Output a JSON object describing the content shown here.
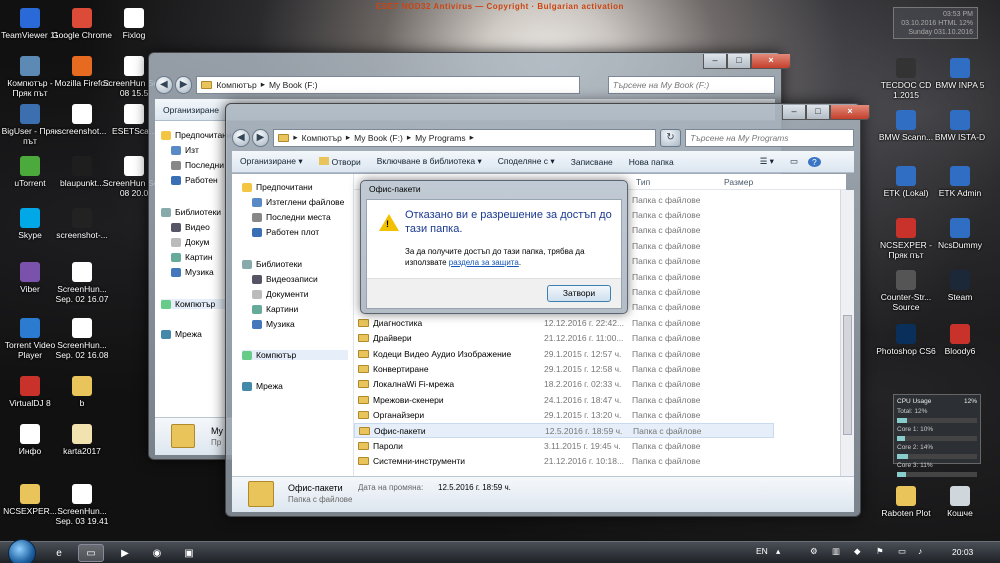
{
  "watermark": "ESET NOD32 Antivirus — Copyright · Bulgarian activation",
  "clock_widget": [
    "03:53 PM",
    "03.10.2016 HTML 12%",
    "Sunday 031.10.2016"
  ],
  "desktop_left": [
    {
      "label": "TeamViewer 11",
      "icon": "teamviewer-icon",
      "color": "#2a6ad8"
    },
    {
      "label": "Google Chrome",
      "icon": "chrome-icon",
      "color": "#dc4a38"
    },
    {
      "label": "Fixlog",
      "icon": "text-file-icon",
      "color": "#ffffff"
    },
    {
      "label": "Компютър - Пряк път",
      "icon": "computer-shortcut-icon",
      "color": "#5c8ab5"
    },
    {
      "label": "Mozilla Firefox",
      "icon": "firefox-icon",
      "color": "#e66a1f"
    },
    {
      "label": "ScreenHun Sep. 08 15.5",
      "icon": "screenshot-file-icon",
      "color": "#ffffff"
    },
    {
      "label": "BigUser - Пряк път",
      "icon": "user-shortcut-icon",
      "color": "#3b6fb0"
    },
    {
      "label": "screenshot...",
      "icon": "screenshot-file-icon",
      "color": "#ffffff"
    },
    {
      "label": "ESETSca...",
      "icon": "eset-icon",
      "color": "#ffffff"
    },
    {
      "label": "uTorrent",
      "icon": "utorrent-icon",
      "color": "#4caa3c"
    },
    {
      "label": "blaupunkt...",
      "icon": "folder-icon",
      "color": "#1e1e1e"
    },
    {
      "label": "ScreenHun Sep. 08 20.0",
      "icon": "screenshot-file-icon",
      "color": "#ffffff"
    },
    {
      "label": "Skype",
      "icon": "skype-icon",
      "color": "#00a8e8"
    },
    {
      "label": "screenshot-...",
      "icon": "screenshot-file-icon",
      "color": "#222222"
    },
    {
      "label": "Viber",
      "icon": "viber-icon",
      "color": "#7b52ab"
    },
    {
      "label": "ScreenHun... Sep. 02 16.07",
      "icon": "screenshot-file-icon",
      "color": "#ffffff"
    },
    {
      "label": "Torrent Video Player",
      "icon": "torrent-player-icon",
      "color": "#2b7bd0"
    },
    {
      "label": "ScreenHun... Sep. 02 16.08",
      "icon": "screenshot-file-icon",
      "color": "#ffffff"
    },
    {
      "label": "VirtualDJ 8",
      "icon": "virtualdj-icon",
      "color": "#c8322b"
    },
    {
      "label": "b",
      "icon": "file-icon",
      "color": "#e8c45a"
    },
    {
      "label": "Инфо",
      "icon": "document-icon",
      "color": "#ffffff"
    },
    {
      "label": "karta2017",
      "icon": "zip-icon",
      "color": "#f2e2b0"
    },
    {
      "label": "NCSEXPER...",
      "icon": "ncsexpert-icon",
      "color": "#e8c45a"
    },
    {
      "label": "ScreenHun... Sep. 03 19.41",
      "icon": "screenshot-file-icon",
      "color": "#ffffff"
    }
  ],
  "desktop_right": [
    {
      "label": "TECDOC CD 1.2015",
      "icon": "tecdoc-icon",
      "color": "#333333"
    },
    {
      "label": "BMW INPA 5",
      "icon": "bmw-icon",
      "color": "#2f6ec2"
    },
    {
      "label": "BMW Scann...",
      "icon": "bmw-scanner-icon",
      "color": "#2f6ec2"
    },
    {
      "label": "BMW ISTA-D",
      "icon": "bmw-ista-icon",
      "color": "#2f6ec2"
    },
    {
      "label": "ETK (Lokal)",
      "icon": "etk-icon",
      "color": "#2f6ec2"
    },
    {
      "label": "ETK Admin",
      "icon": "etk-admin-icon",
      "color": "#2f6ec2"
    },
    {
      "label": "NCSEXPER - Пряк път",
      "icon": "ncsexpert-icon",
      "color": "#c8322b"
    },
    {
      "label": "NcsDummy",
      "icon": "ncsdummy-icon",
      "color": "#2f6ec2"
    },
    {
      "label": "Counter-Str... Source",
      "icon": "counter-strike-icon",
      "color": "#555555"
    },
    {
      "label": "Steam",
      "icon": "steam-icon",
      "color": "#1b2838"
    },
    {
      "label": "Photoshop CS6",
      "icon": "photoshop-icon",
      "color": "#0a2f5a"
    },
    {
      "label": "Bloody6",
      "icon": "bloody-icon",
      "color": "#c8322b"
    },
    {
      "label": "Raboten Plot",
      "icon": "folder-icon",
      "color": "#e8c45a"
    },
    {
      "label": "Кошче",
      "icon": "recycle-bin-icon",
      "color": "#cfd6dc"
    }
  ],
  "back_window": {
    "path": [
      "Компютър",
      "My Book (F:)"
    ],
    "search_placeholder": "Търсене на My Book (F:)",
    "organize": "Организиране",
    "nav": [
      "Предпочитани",
      "Изт",
      "Последни",
      "Работен",
      "Библиотеки",
      "Видео",
      "Докум",
      "Картин",
      "Музика",
      "Компютър",
      "Мрежа"
    ],
    "details_name": "My",
    "details_type": "Пр"
  },
  "front_window": {
    "path": [
      "Компютър",
      "My Book (F:)",
      "My Programs"
    ],
    "search_placeholder": "Търсене на My Programs",
    "toolbar": [
      "Организиране",
      "Отвори",
      "Включване в библиотека",
      "Споделяне с",
      "Записване",
      "Нова папка"
    ],
    "columns": {
      "type": "Тип",
      "size": "Размер"
    },
    "nav": {
      "favorites": "Предпочитани",
      "favorites_items": [
        "Изтеглени файлове",
        "Последни места",
        "Работен плот"
      ],
      "libraries": "Библиотеки",
      "libraries_items": [
        "Видеозаписи",
        "Документи",
        "Картини",
        "Музика"
      ],
      "computer": "Компютър",
      "network": "Мрежа"
    },
    "rows": [
      {
        "name": "",
        "date": "",
        "type": "Папка с файлове"
      },
      {
        "name": "",
        "date": "",
        "type": "Папка с файлове"
      },
      {
        "name": "",
        "date": "",
        "type": "Папка с файлове"
      },
      {
        "name": "",
        "date": "",
        "type": "Папка с файлове"
      },
      {
        "name": "",
        "date": "",
        "type": "Папка с файлове"
      },
      {
        "name": "",
        "date": "",
        "type": "Папка с файлове"
      },
      {
        "name": "",
        "date": "",
        "type": "Папка с файлове"
      },
      {
        "name": "",
        "date": "",
        "type": "Папка с файлове"
      },
      {
        "name": "Диагностика",
        "date": "12.12.2016 г. 22:42...",
        "type": "Папка с файлове"
      },
      {
        "name": "Драйвери",
        "date": "21.12.2016 г. 11:00...",
        "type": "Папка с файлове"
      },
      {
        "name": "Кодеци Видео Аудио Изображение",
        "date": "29.1.2015 г. 12:57 ч.",
        "type": "Папка с файлове"
      },
      {
        "name": "Конвертиране",
        "date": "29.1.2015 г. 12:58 ч.",
        "type": "Папка с файлове"
      },
      {
        "name": "ЛокалнаWi Fi-мрежа",
        "date": "18.2.2016 г. 02:33 ч.",
        "type": "Папка с файлове"
      },
      {
        "name": "Мрежови-скенери",
        "date": "24.1.2016 г. 18:47 ч.",
        "type": "Папка с файлове"
      },
      {
        "name": "Органайзери",
        "date": "29.1.2015 г. 13:20 ч.",
        "type": "Папка с файлове"
      },
      {
        "name": "Офис-пакети",
        "date": "12.5.2016 г. 18:59 ч.",
        "type": "Папка с файлове"
      },
      {
        "name": "Пароли",
        "date": "3.11.2015 г. 19:45 ч.",
        "type": "Папка с файлове"
      },
      {
        "name": "Системни-инструменти",
        "date": "21.12.2016 г. 10:18...",
        "type": "Папка с файлове"
      }
    ],
    "selected_index": 15,
    "details": {
      "name": "Офис-пакети",
      "type": "Папка с файлове",
      "modified_label": "Дата на промяна:",
      "modified_value": "12.5.2016 г. 18:59 ч."
    }
  },
  "dialog": {
    "title": "Офис-пакети",
    "heading": "Отказано ви е разрешение за достъп до тази папка.",
    "body": "За да получите достъп до тази папка, трябва да използвате",
    "link": "раздела за защита",
    "body_end": ".",
    "button": "Затвори"
  },
  "gadget": {
    "title": "CPU Usage",
    "percent": "12%",
    "lines": [
      "Total: 12%",
      "Core 1: 10%",
      "Core 2: 14%",
      "Core 3: 11%"
    ],
    "levels": [
      0.12,
      0.1,
      0.14,
      0.11
    ]
  },
  "taskbar": {
    "lang": "EN",
    "time": "20:03"
  }
}
